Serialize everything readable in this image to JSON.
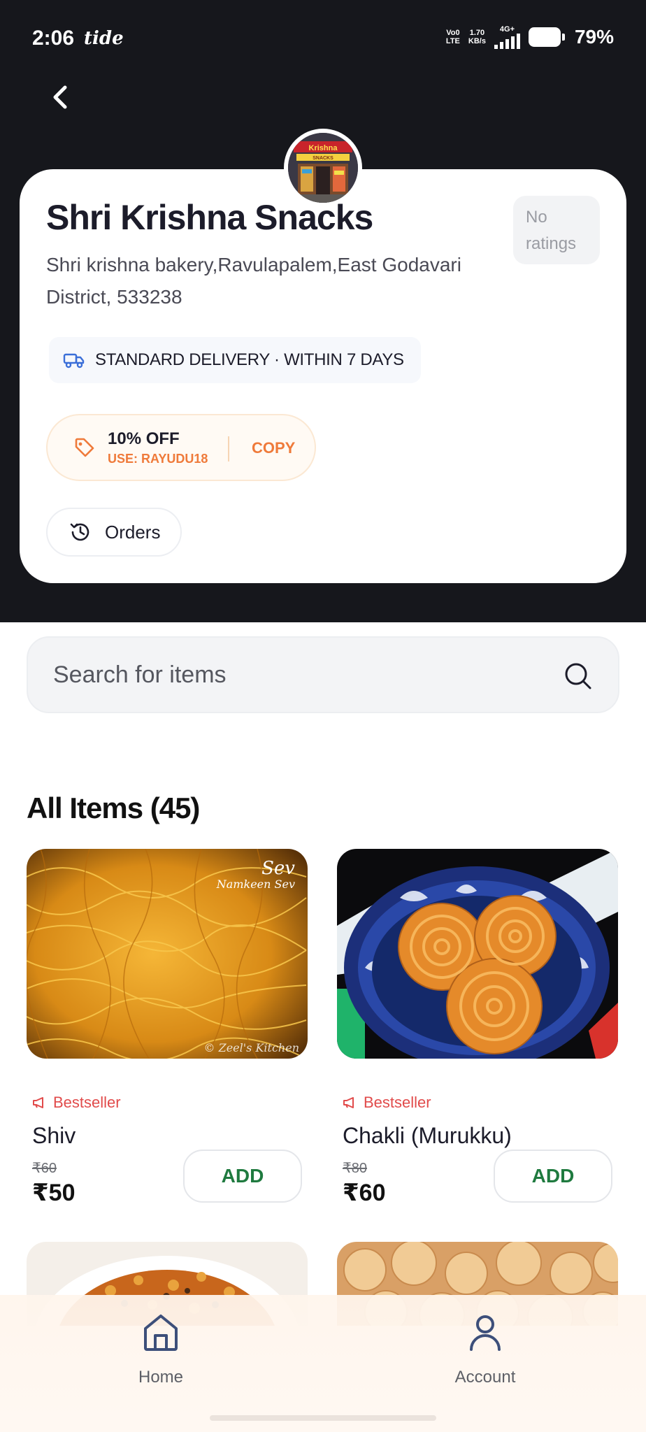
{
  "status_bar": {
    "time": "2:06",
    "app_indicator": "tide",
    "network_lines": [
      "Vo0",
      "LTE"
    ],
    "speed_lines": [
      "1.70",
      "KB/s"
    ],
    "network_type": "4G+",
    "battery": "79%"
  },
  "store": {
    "name": "Shri Krishna Snacks",
    "address": "Shri krishna bakery,Ravulapalem,East Godavari District, 533238",
    "rating": "No ratings",
    "logo_sign": "Krishna",
    "logo_sub": "SNACKS",
    "delivery": "STANDARD DELIVERY · WITHIN 7 DAYS",
    "coupon": {
      "title": "10% OFF",
      "code": "USE: RAYUDU18",
      "copy_label": "COPY"
    },
    "orders_label": "Orders"
  },
  "search": {
    "placeholder": "Search for items"
  },
  "catalog": {
    "title": "All Items (45)",
    "items": [
      {
        "badge": "Bestseller",
        "name": "Shiv",
        "mrp": "₹60",
        "price": "₹50",
        "add_label": "ADD",
        "image_caption": "Sev",
        "image_subcaption": "Namkeen Sev",
        "image_watermark": "© Zeel's Kitchen"
      },
      {
        "badge": "Bestseller",
        "name": "Chakli (Murukku)",
        "mrp": "₹80",
        "price": "₹60",
        "add_label": "ADD"
      }
    ]
  },
  "bottom_nav": {
    "items": [
      {
        "label": "Home",
        "icon": "home-icon"
      },
      {
        "label": "Account",
        "icon": "person-icon"
      }
    ]
  },
  "colors": {
    "hero_bg": "#16171c",
    "accent_orange": "#ef7a3a",
    "bestseller_red": "#e14b4b",
    "add_green": "#1f7a3f"
  }
}
